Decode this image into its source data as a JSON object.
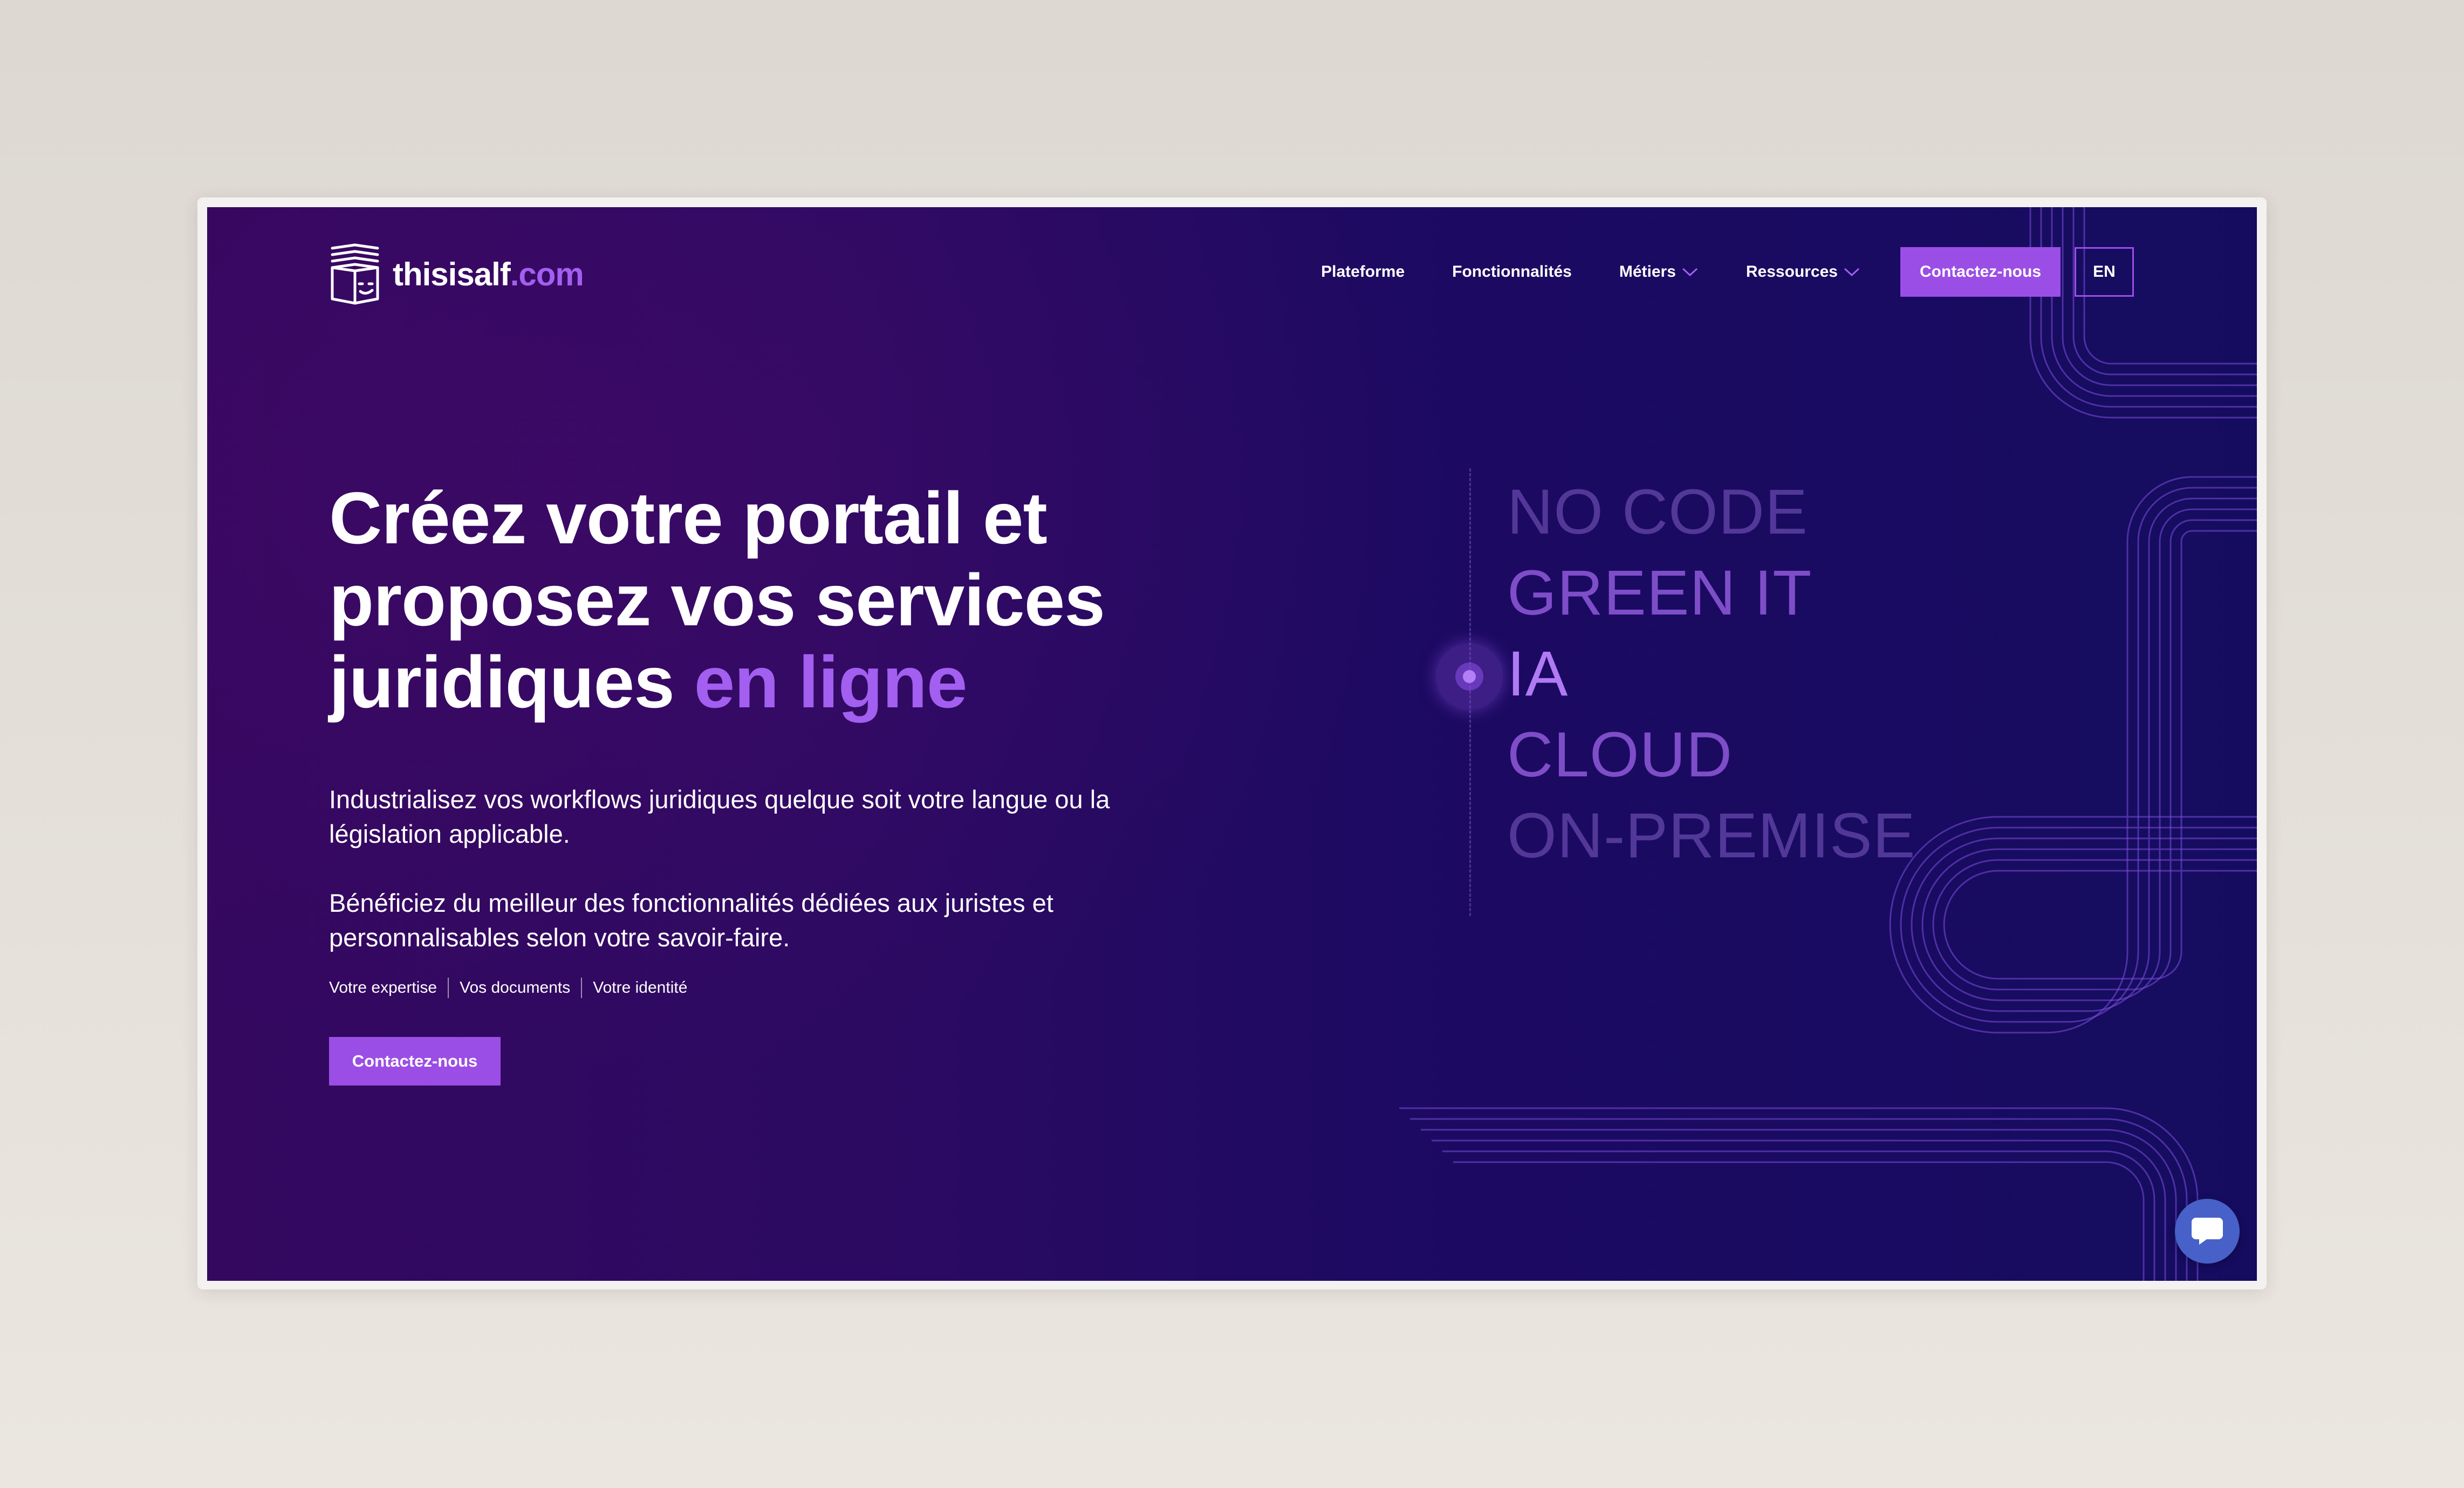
{
  "brand": {
    "logo_name": "thisisalf",
    "logo_tld": ".com",
    "logo_icon": "box-face-icon",
    "accent_color": "#a25ff0",
    "button_color": "#9b4ee6"
  },
  "nav": {
    "items": [
      {
        "label": "Plateforme"
      },
      {
        "label": "Fonctionnalités"
      },
      {
        "label": "Métiers",
        "has_dropdown": true
      },
      {
        "label": "Ressources",
        "has_dropdown": true
      }
    ],
    "contact_label": "Contactez-nous",
    "language_label": "EN"
  },
  "hero": {
    "title_line1": "Créez votre portail et",
    "title_line2": "proposez vos services",
    "title_line3_start": "juridiques",
    "title_line3_accent": "en ligne",
    "paragraph1": "Industrialisez vos workflows juridiques quelque soit votre langue ou la législation applicable.",
    "paragraph2": "Bénéficiez du meilleur des fonctionnalités dédiées aux juristes et personnalisables selon votre savoir-faire.",
    "tags": [
      "Votre expertise",
      "Vos documents",
      "Votre identité"
    ],
    "cta_label": "Contactez-nous"
  },
  "keywords": {
    "items": [
      "NO CODE",
      "GREEN IT",
      "IA",
      "CLOUD",
      "ON-PREMISE"
    ],
    "active": "IA"
  },
  "chat": {
    "icon": "chat-bubble-icon"
  }
}
